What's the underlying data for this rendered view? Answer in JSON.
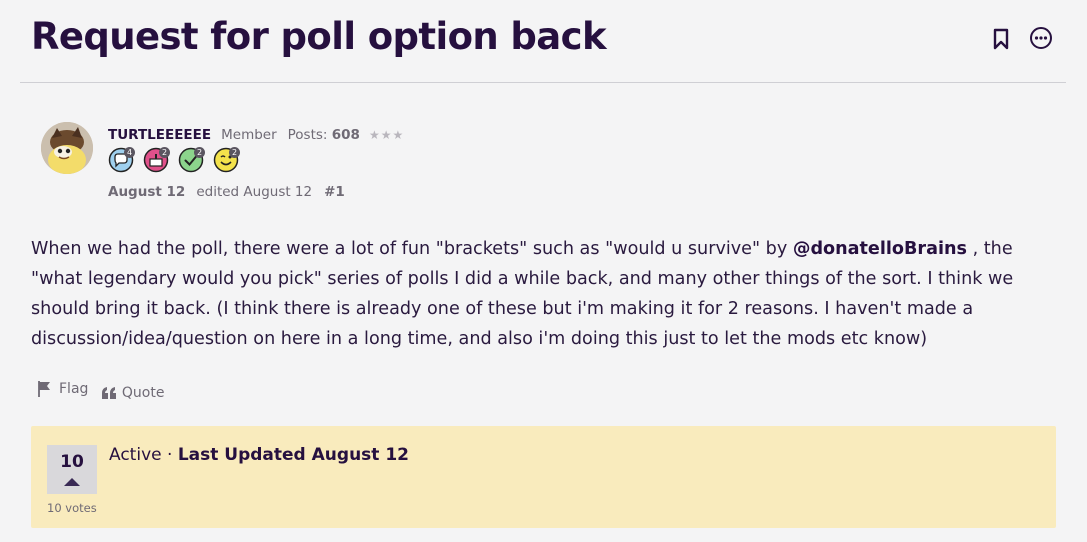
{
  "discussion": {
    "title": "Request for poll option back"
  },
  "author": {
    "name": "TURTLEEEEEE",
    "role": "Member",
    "posts_label": "Posts:",
    "posts_count": "608",
    "rank_stars": "★★★",
    "badges": [
      {
        "icon": "comment-badge-icon",
        "count": "4",
        "color": "#9fd0ee"
      },
      {
        "icon": "cake-badge-icon",
        "count": "2",
        "color": "#e0508a"
      },
      {
        "icon": "check-badge-icon",
        "count": "2",
        "color": "#8cd48c"
      },
      {
        "icon": "wink-badge-icon",
        "count": "2",
        "color": "#f3e24b"
      }
    ]
  },
  "post": {
    "date": "August 12",
    "edited": "edited August 12",
    "number": "#1",
    "body_before": "When we had the poll, there were a lot of fun \"brackets\" such as \"would u survive\" by ",
    "mention": "@donatelloBrains",
    "body_after": " , the \"what legendary would you pick\" series of polls I did a while back, and many other things of the sort. I think we should bring it back. (I think there is already one of these but i'm making it for 2 reasons. I haven't made a discussion/idea/question on here in a long time, and also i'm doing this just to let the mods etc know)"
  },
  "actions": {
    "flag": "Flag",
    "quote": "Quote"
  },
  "status": {
    "vote_count": "10",
    "votes_label": "10 votes",
    "state": "Active",
    "separator": " · ",
    "updated": "Last Updated August 12",
    "background": "#f9ebbd"
  },
  "colors": {
    "title": "#26103f",
    "text": "#2a1a3f",
    "muted": "#6f6a75"
  }
}
